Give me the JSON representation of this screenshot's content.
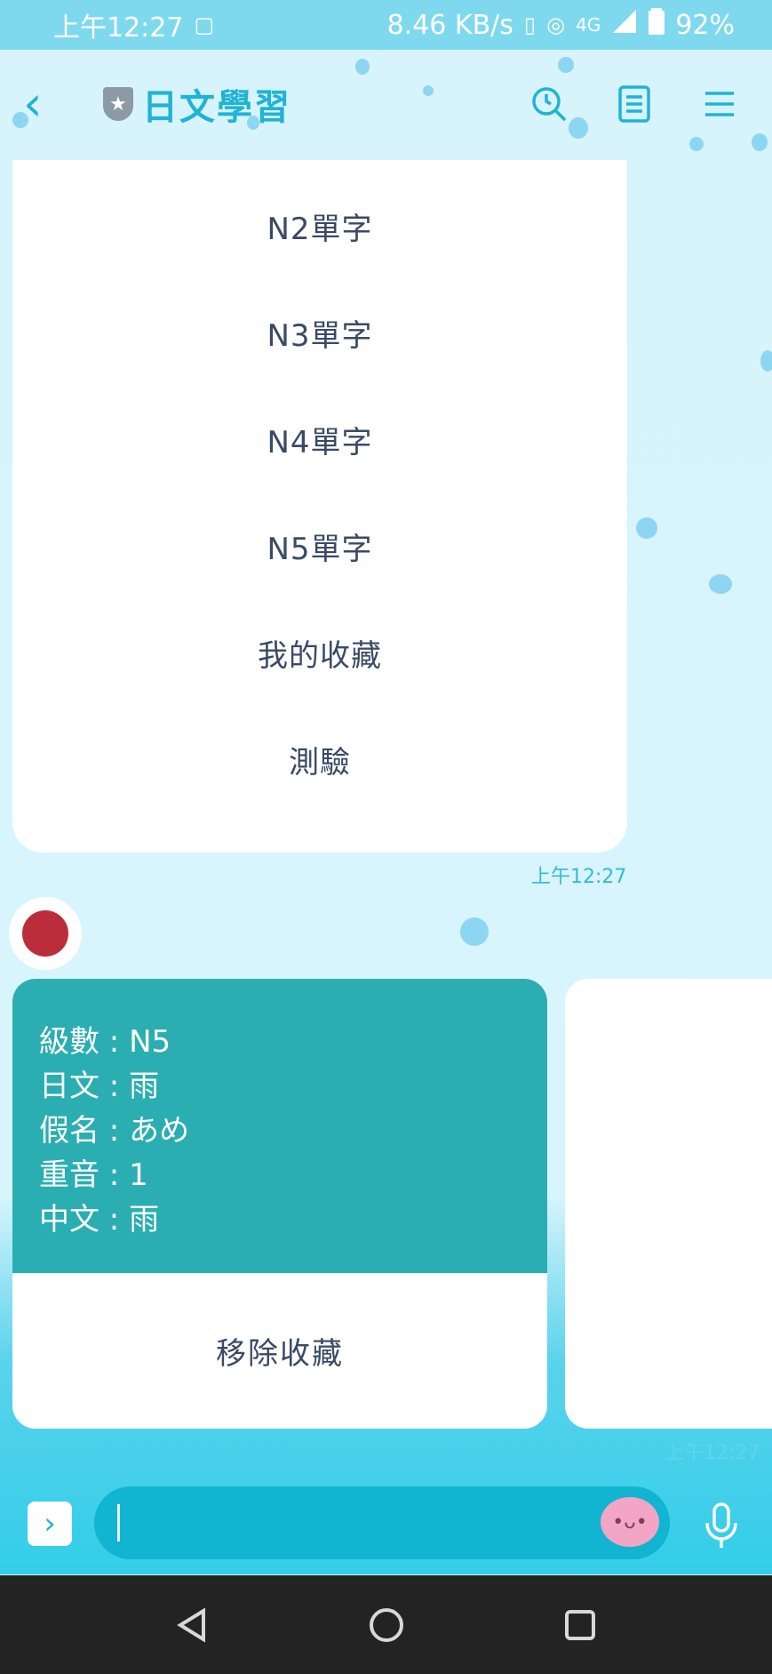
{
  "status_bar": {
    "time": "上午12:27",
    "network_speed": "8.46 KB/s",
    "network_type": "4G",
    "battery": "92%",
    "icons": [
      "image-icon",
      "vibrate-icon",
      "hotspot-icon",
      "signal-icon",
      "battery-icon"
    ]
  },
  "header": {
    "title": "日文學習",
    "icons": [
      "back-icon",
      "shield-icon",
      "search-icon",
      "notes-icon",
      "menu-icon"
    ]
  },
  "menu_card": {
    "items": [
      "N2單字",
      "N3單字",
      "N4單字",
      "N5單字",
      "我的收藏",
      "測驗"
    ],
    "timestamp": "上午12:27"
  },
  "word_card": {
    "lines": [
      "級數 : N5",
      "日文 : 雨",
      "假名 :  あめ",
      "重音 : 1",
      "中文 :  雨"
    ],
    "action_label": "移除收藏",
    "timestamp": "上午12:27"
  },
  "input_bar": {
    "text": "",
    "icons": [
      "expand-icon",
      "emoji-icon",
      "mic-icon"
    ]
  },
  "nav_bar": {
    "icons": [
      "nav-back-icon",
      "home-icon",
      "recents-icon"
    ]
  },
  "colors": {
    "accent": "#1fb4d6",
    "card_header": "#2aaeb2",
    "status_bar": "#7fd9ee",
    "chat_background": "#d9f3fb",
    "input_field": "#11b4d1",
    "avatar": "#bb2d3b"
  }
}
